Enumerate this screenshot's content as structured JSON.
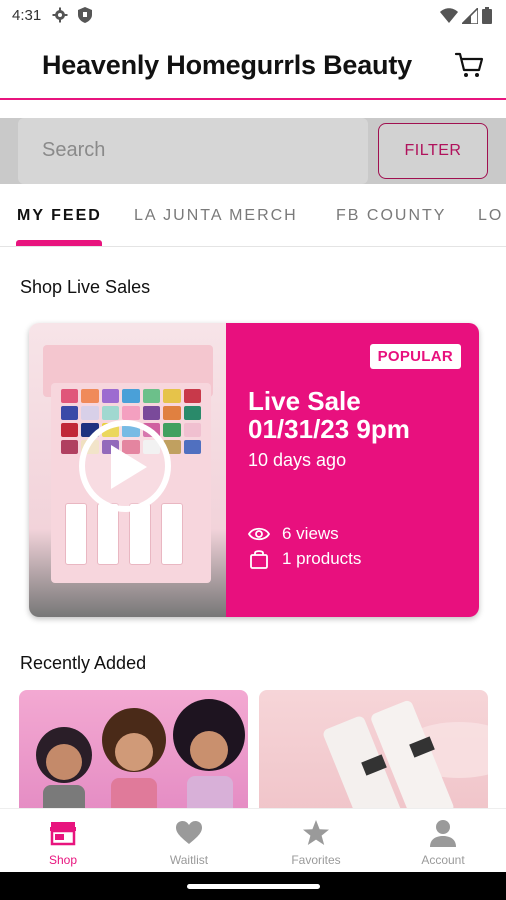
{
  "status": {
    "time": "4:31",
    "icons": [
      "gear-icon",
      "shield-icon",
      "wifi-icon",
      "signal-icon",
      "battery-icon"
    ]
  },
  "header": {
    "title": "Heavenly Homegurrls Beauty",
    "cart_icon": "cart-icon"
  },
  "search": {
    "placeholder": "Search",
    "filter_label": "FILTER"
  },
  "tabs": [
    {
      "label": "MY FEED",
      "active": true
    },
    {
      "label": "LA JUNTA MERCH",
      "active": false
    },
    {
      "label": "FB COUNTY",
      "active": false
    },
    {
      "label": "LO",
      "active": false
    }
  ],
  "live_section": {
    "heading": "Shop Live Sales",
    "card": {
      "badge": "POPULAR",
      "title_line1": "Live Sale",
      "title_line2": "01/31/23 9pm",
      "ago": "10 days ago",
      "views": "6 views",
      "products": "1 products"
    }
  },
  "recent_section": {
    "heading": "Recently Added"
  },
  "bottom_nav": [
    {
      "label": "Shop",
      "icon": "store-icon",
      "active": true
    },
    {
      "label": "Waitlist",
      "icon": "heart-icon",
      "active": false
    },
    {
      "label": "Favorites",
      "icon": "star-icon",
      "active": false
    },
    {
      "label": "Account",
      "icon": "person-icon",
      "active": false
    }
  ],
  "colors": {
    "accent": "#e8147e",
    "inactive": "#9a9a9a"
  }
}
